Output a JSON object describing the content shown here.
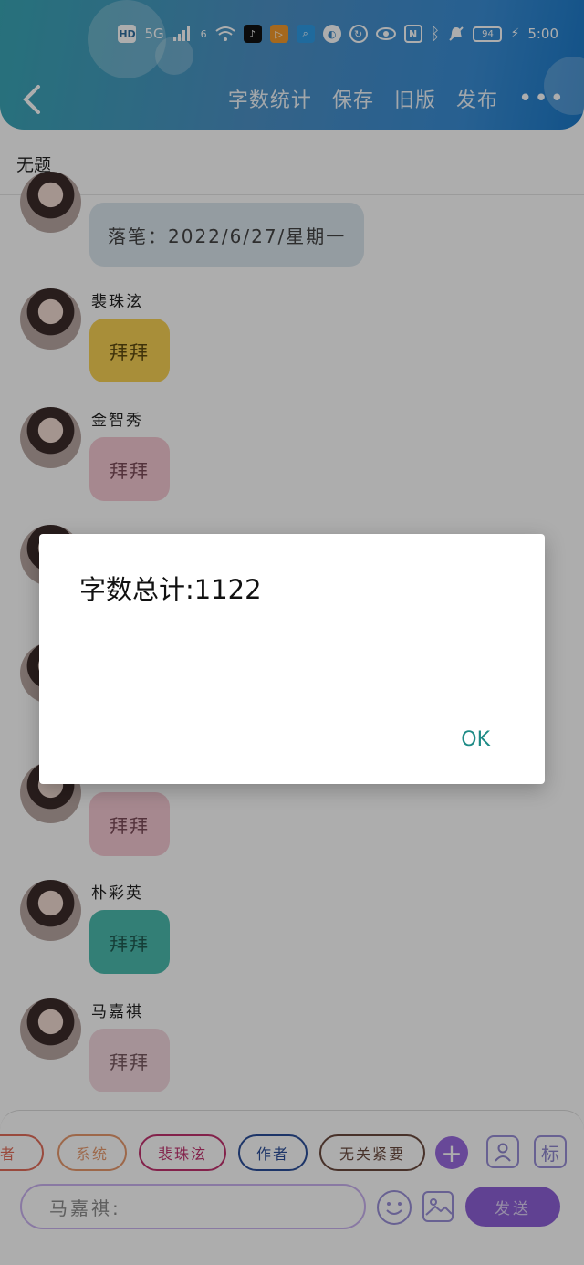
{
  "status_bar": {
    "hd": "HD",
    "network": "5G",
    "network2": "6",
    "battery": "94",
    "time": "5:00",
    "icons": [
      "signal-icon",
      "wifi-icon",
      "tiktok-icon",
      "app-icon",
      "search-app-icon",
      "sync-icon",
      "eye-icon",
      "nfc-icon",
      "bluetooth-icon",
      "mute-icon",
      "charging-icon"
    ]
  },
  "header": {
    "actions": [
      "字数统计",
      "保存",
      "旧版",
      "发布"
    ],
    "more": "•••"
  },
  "subtitle": "无题",
  "messages": [
    {
      "name": "",
      "text": "落笔：2022/6/27/星期一",
      "color": "gray"
    },
    {
      "name": "裴珠泫",
      "text": "拜拜",
      "color": "yellow"
    },
    {
      "name": "金智秀",
      "text": "拜拜",
      "color": "pink"
    },
    {
      "name": "",
      "text": "拜拜",
      "color": "pink"
    },
    {
      "name": "朴彩英",
      "text": "拜拜",
      "color": "teal"
    },
    {
      "name": "马嘉祺",
      "text": "拜拜",
      "color": "light"
    }
  ],
  "dialog": {
    "text": "字数总计:1122",
    "ok": "OK"
  },
  "chips": [
    "者",
    "系统",
    "裴珠泫",
    "作者",
    "无关紧要"
  ],
  "chip_colors": [
    "#e26d5a",
    "#e79a6e",
    "#c2336f",
    "#2c4f9a",
    "#6b4a3f"
  ],
  "tools": {
    "plus": "+",
    "tag": "标"
  },
  "input": {
    "value": "马嘉祺:"
  },
  "send": "发送"
}
